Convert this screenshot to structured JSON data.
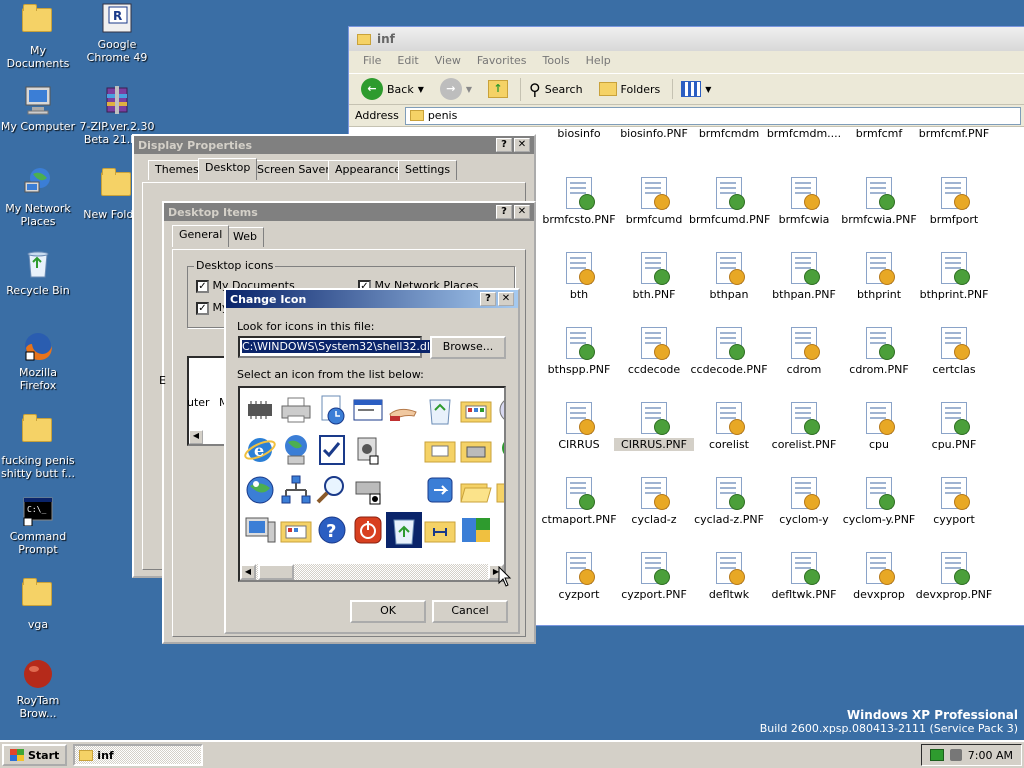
{
  "desktop": {
    "icons": [
      {
        "label": "My Documents",
        "icon": "my-documents-icon"
      },
      {
        "label": "Google Chrome 49",
        "icon": "chrome-installer-icon"
      },
      {
        "label": "My Computer",
        "icon": "my-computer-icon"
      },
      {
        "label": "7-ZIP.ver.2.30 Beta 21.M...",
        "icon": "winrar-archive-icon"
      },
      {
        "label": "My Network Places",
        "icon": "network-places-icon"
      },
      {
        "label": "New Folde...",
        "icon": "folder-icon"
      },
      {
        "label": "Recycle Bin",
        "icon": "recycle-bin-icon"
      },
      {
        "label": "Mozilla Firefox",
        "icon": "firefox-icon"
      },
      {
        "label": "fucking penis shitty butt f...",
        "icon": "folder-icon"
      },
      {
        "label": "Command Prompt",
        "icon": "command-prompt-icon"
      },
      {
        "label": "vga",
        "icon": "folder-icon"
      },
      {
        "label": "RoyTam Brow...",
        "icon": "browser-ball-icon"
      }
    ],
    "watermark_title": "Windows XP Professional",
    "watermark_build": "Build 2600.xpsp.080413-2111 (Service Pack 3)"
  },
  "explorer": {
    "title": "inf",
    "menu": [
      "File",
      "Edit",
      "View",
      "Favorites",
      "Tools",
      "Help"
    ],
    "toolbar": {
      "back": "Back",
      "search": "Search",
      "folders": "Folders"
    },
    "address_label": "Address",
    "address_value": "penis",
    "files": [
      [
        "biosinfo",
        "biosinfo.PNF",
        "brmfcmdm",
        "brmfcmdm....",
        "brmfcmf",
        "brmfcmf.PNF"
      ],
      [
        "brmfcsto.PNF",
        "brmfcumd",
        "brmfcumd.PNF",
        "brmfcwia",
        "brmfcwia.PNF",
        "brmfport"
      ],
      [
        "bth",
        "bth.PNF",
        "bthpan",
        "bthpan.PNF",
        "bthprint",
        "bthprint.PNF"
      ],
      [
        "bthspp.PNF",
        "ccdecode",
        "ccdecode.PNF",
        "cdrom",
        "cdrom.PNF",
        "certclas"
      ],
      [
        "CIRRUS",
        "CIRRUS.PNF",
        "corelist",
        "corelist.PNF",
        "cpu",
        "cpu.PNF"
      ],
      [
        "ctmaport.PNF",
        "cyclad-z",
        "cyclad-z.PNF",
        "cyclom-y",
        "cyclom-y.PNF",
        "cyyport"
      ],
      [
        "cyzport",
        "cyzport.PNF",
        "defltwk",
        "defltwk.PNF",
        "devxprop",
        "devxprop.PNF"
      ]
    ],
    "selected_file": "CIRRUS.PNF"
  },
  "display_properties": {
    "title": "Display Properties",
    "tabs": [
      "Themes",
      "Desktop",
      "Screen Saver",
      "Appearance",
      "Settings"
    ],
    "active_tab": "Desktop"
  },
  "desktop_items": {
    "title": "Desktop Items",
    "tabs": [
      "General",
      "Web"
    ],
    "active_tab": "General",
    "group_label": "Desktop icons",
    "checkboxes": [
      {
        "label": "My Documents",
        "checked": true
      },
      {
        "label": "My Network Places",
        "checked": true
      },
      {
        "label": "My",
        "checked": true
      }
    ],
    "list_fragments": [
      "E",
      "uter",
      "M"
    ]
  },
  "change_icon": {
    "title": "Change Icon",
    "file_label": "Look for icons in this file:",
    "file_value": "C:\\WINDOWS\\System32\\shell32.dll",
    "browse_label": "Browse...",
    "list_label": "Select an icon from the list below:",
    "ok_label": "OK",
    "cancel_label": "Cancel"
  },
  "taskbar": {
    "start_label": "Start",
    "task_label": "inf",
    "clock": "7:00 AM"
  },
  "colors": {
    "desktop": "#3a6ea5",
    "active_title_start": "#0a246a",
    "active_title_end": "#a6caf0",
    "inactive_title": "#808080",
    "dialog_face": "#d4d0c8"
  }
}
